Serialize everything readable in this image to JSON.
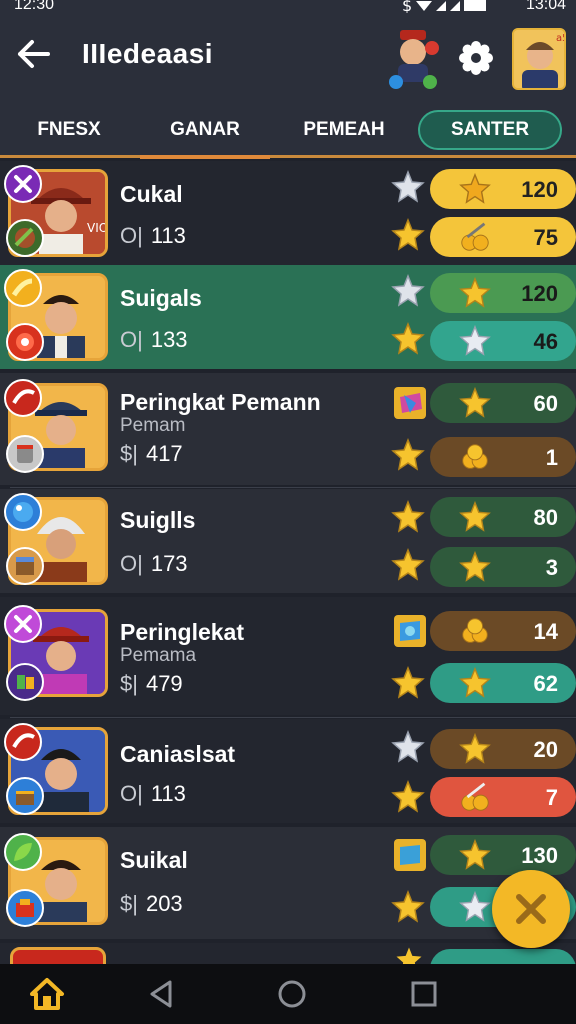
{
  "status_bar": {
    "time_left": "12:30",
    "time_right": "13:04"
  },
  "header": {
    "title": "IIIedeaasi"
  },
  "tabs": [
    {
      "label": "FNESX"
    },
    {
      "label": "GANAR"
    },
    {
      "label": "PEMEAH"
    },
    {
      "label": "SANTER"
    }
  ],
  "selected_tab": "GANAR",
  "profile_badge": "a5",
  "rows": [
    {
      "name": "Cukal",
      "sub": "",
      "stat_prefix": "O|",
      "stat": "113",
      "pill_top_value": "120",
      "pill_bottom_value": "75",
      "avatar_text": "VIO"
    },
    {
      "name": "Suigals",
      "sub": "",
      "stat_prefix": "O|",
      "stat": "133",
      "pill_top_value": "120",
      "pill_bottom_value": "46"
    },
    {
      "name": "Peringkat Pemann",
      "sub": "Pemam",
      "stat_prefix": "$|",
      "stat": "417",
      "pill_top_value": "60",
      "pill_bottom_value": "1"
    },
    {
      "name": "Suiglls",
      "sub": "",
      "stat_prefix": "O|",
      "stat": "173",
      "pill_top_value": "80",
      "pill_bottom_value": "3"
    },
    {
      "name": "Peringlekat",
      "sub": "Pemama",
      "stat_prefix": "$|",
      "stat": "479",
      "pill_top_value": "14",
      "pill_bottom_value": "62"
    },
    {
      "name": "Caniaslsat",
      "sub": "",
      "stat_prefix": "O|",
      "stat": "113",
      "pill_top_value": "20",
      "pill_bottom_value": "7"
    },
    {
      "name": "Suikal",
      "sub": "",
      "stat_prefix": "$|",
      "stat": "203",
      "pill_top_value": "130",
      "pill_bottom_value": ""
    }
  ],
  "colors": {
    "accent_orange": "#e08a3a",
    "pill_yellow": "#f4c53a",
    "pill_green": "#2e5a3e",
    "pill_teal": "#2f9c86",
    "pill_brown": "#6b4a26",
    "pill_red": "#e0553f",
    "fab_yellow": "#f3b826"
  }
}
